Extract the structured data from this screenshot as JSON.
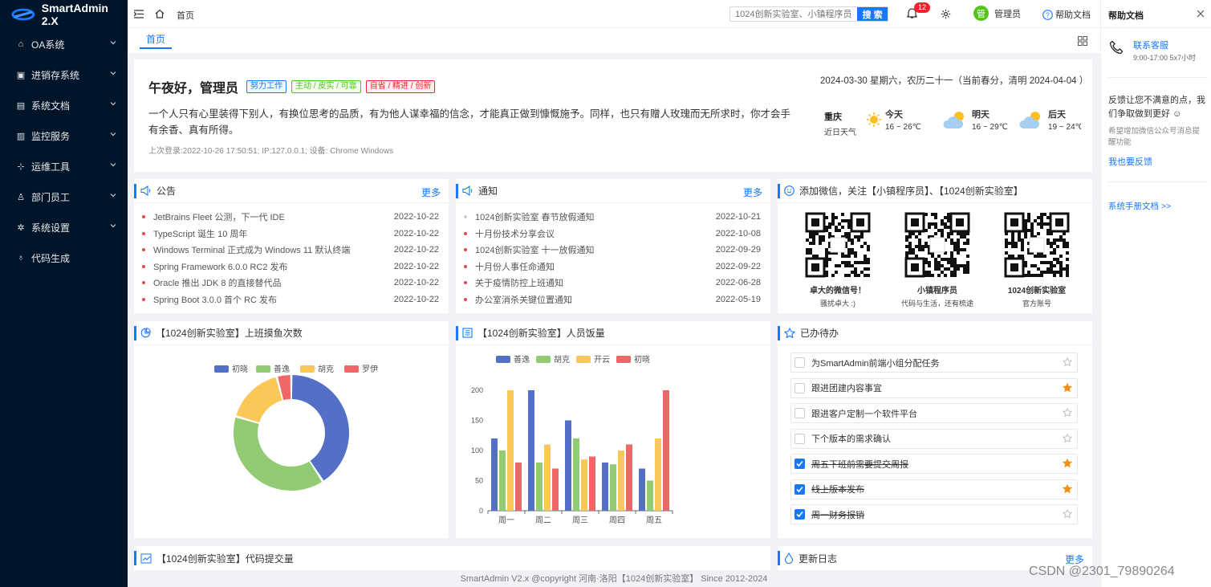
{
  "app": {
    "title": "SmartAdmin 2.X"
  },
  "sidebar": {
    "items": [
      {
        "label": "OA系统",
        "icon": "bank-icon"
      },
      {
        "label": "进销存系统",
        "icon": "calendar-icon"
      },
      {
        "label": "系统文档",
        "icon": "file-icon"
      },
      {
        "label": "监控服务",
        "icon": "bar-chart-icon"
      },
      {
        "label": "运维工具",
        "icon": "tools-icon"
      },
      {
        "label": "部门员工",
        "icon": "user-icon"
      },
      {
        "label": "系统设置",
        "icon": "gear-icon"
      },
      {
        "label": "代码生成",
        "icon": "code-icon"
      }
    ]
  },
  "header": {
    "breadcrumb": "首页",
    "search_placeholder": "1024创新实验室、小镇程序员",
    "search_button": "搜 索",
    "notification_count": "12",
    "user_avatar": "管",
    "user_name": "管理员",
    "help_label": "帮助文档"
  },
  "tabs": {
    "home": "首页"
  },
  "welcome": {
    "greeting": "午夜好，管理员",
    "tags": [
      {
        "label": "努力工作",
        "color": "#1677ff"
      },
      {
        "label": "主动 / 皮实 / 可靠",
        "color": "#52c41a"
      },
      {
        "label": "自省 / 精进 / 创新",
        "color": "#f5222d"
      }
    ],
    "quote_line1": "一个人只有心里装得下别人，有换位思考的品质，有为他人谋幸福的信念，才能真正做到慷慨施予。同样，也只有赠人玫瑰而无所求时，你才会手",
    "quote_line2": "有余香、真有所得。",
    "last_login": "上次登录:2022-10-26 17:50:51; IP:127.0.0.1; 设备: Chrome Windows",
    "date_line": "2024-03-30 星期六，农历二十一（当前春分，清明 2024-04-04 ）",
    "weather": {
      "city": "重庆",
      "city_sub": "近日天气",
      "days": [
        {
          "label": "今天",
          "temp": "16 ~ 26℃",
          "icon": "sun-icon"
        },
        {
          "label": "明天",
          "temp": "16 ~ 29℃",
          "icon": "cloud-sun-icon"
        },
        {
          "label": "后天",
          "temp": "19 ~ 24℃",
          "icon": "cloud-sun-icon"
        }
      ]
    }
  },
  "notice": {
    "title": "公告",
    "more": "更多",
    "items": [
      {
        "text": "JetBrains Fleet 公测，下一代 IDE",
        "date": "2022-10-22"
      },
      {
        "text": "TypeScript 诞生 10 周年",
        "date": "2022-10-22"
      },
      {
        "text": "Windows Terminal 正式成为 Windows 11 默认终端",
        "date": "2022-10-22"
      },
      {
        "text": "Spring Framework 6.0.0 RC2 发布",
        "date": "2022-10-22"
      },
      {
        "text": "Oracle 推出 JDK 8 的直接替代品",
        "date": "2022-10-22"
      },
      {
        "text": "Spring Boot 3.0.0 首个 RC 发布",
        "date": "2022-10-22"
      }
    ]
  },
  "inform": {
    "title": "通知",
    "more": "更多",
    "items": [
      {
        "text": "1024创新实验室 春节放假通知",
        "date": "2022-10-21"
      },
      {
        "text": "十月份技术分享会议",
        "date": "2022-10-08"
      },
      {
        "text": "1024创新实验室 十一放假通知",
        "date": "2022-09-29"
      },
      {
        "text": "十月份人事任命通知",
        "date": "2022-09-22"
      },
      {
        "text": "关于疫情防控上班通知",
        "date": "2022-06-28"
      },
      {
        "text": "办公室消杀关键位置通知",
        "date": "2022-05-19"
      }
    ]
  },
  "wechat": {
    "title": "添加微信，关注【小镇程序员】、【1024创新实验室】",
    "cards": [
      {
        "name": "卓大的微信号！",
        "sub": "骚扰卓大 :)"
      },
      {
        "name": "小镇程序员",
        "sub": "代码与生活，还有梳途"
      },
      {
        "name": "1024创新实验室",
        "sub": "官方账号"
      }
    ]
  },
  "chart1": {
    "title": "【1024创新实验室】上班摸鱼次数"
  },
  "chart2": {
    "title": "【1024创新实验室】人员饭量"
  },
  "chart3": {
    "title": "【1024创新实验室】代码提交量"
  },
  "todo": {
    "title": "已办待办",
    "items": [
      {
        "text": "为SmartAdmin前端小组分配任务",
        "checked": false,
        "starred": false
      },
      {
        "text": "跟进团建内容事宜",
        "checked": false,
        "starred": true
      },
      {
        "text": "跟进客户定制一个软件平台",
        "checked": false,
        "starred": false
      },
      {
        "text": "下个版本的需求确认",
        "checked": false,
        "starred": false
      },
      {
        "text": "周五下班前需要提交周报",
        "checked": true,
        "starred": true
      },
      {
        "text": "线上版本发布",
        "checked": true,
        "starred": true
      },
      {
        "text": "周一财务报销",
        "checked": true,
        "starred": false
      }
    ]
  },
  "changelog": {
    "title": "更新日志",
    "more": "更多"
  },
  "help": {
    "title": "帮助文档",
    "contact_title": "联系客服",
    "contact_sub": "9:00-17:00 5x7小时",
    "feedback_text": "反馈让您不满意的点，我们争取做到更好 ☺",
    "feedback_hint": "希望增加微信公众号消息提醒功能",
    "feedback_link": "我也要反馈",
    "manual_link": "系统手册文档 >>"
  },
  "footer": {
    "text": "SmartAdmin V2.x @copyright 河南·洛阳【1024创新实验室】 Since 2012-2024"
  },
  "corner_watermark": "CSDN @2301_79890264",
  "chart_data": [
    {
      "type": "pie",
      "title": "【1024创新实验室】上班摸鱼次数",
      "categories": [
        "初晓",
        "善逸",
        "胡克",
        "罗伊"
      ],
      "values": [
        40,
        38,
        16,
        4
      ],
      "colors": [
        "#5470c6",
        "#91cc75",
        "#fac858",
        "#ee6666"
      ],
      "donut": true,
      "legend": "top"
    },
    {
      "type": "bar",
      "title": "【1024创新实验室】人员饭量",
      "categories": [
        "周一",
        "周二",
        "周三",
        "周四",
        "周五"
      ],
      "series": [
        {
          "name": "善逸",
          "values": [
            120,
            200,
            150,
            80,
            70
          ],
          "color": "#5470c6"
        },
        {
          "name": "胡克",
          "values": [
            100,
            80,
            120,
            77,
            50
          ],
          "color": "#91cc75"
        },
        {
          "name": "开云",
          "values": [
            200,
            110,
            85,
            100,
            120
          ],
          "color": "#fac858"
        },
        {
          "name": "初晓",
          "values": [
            80,
            70,
            90,
            110,
            200
          ],
          "color": "#ee6666"
        }
      ],
      "yticks": [
        0,
        50,
        100,
        150,
        200
      ],
      "ylim": [
        0,
        200
      ],
      "legend": "top"
    }
  ]
}
